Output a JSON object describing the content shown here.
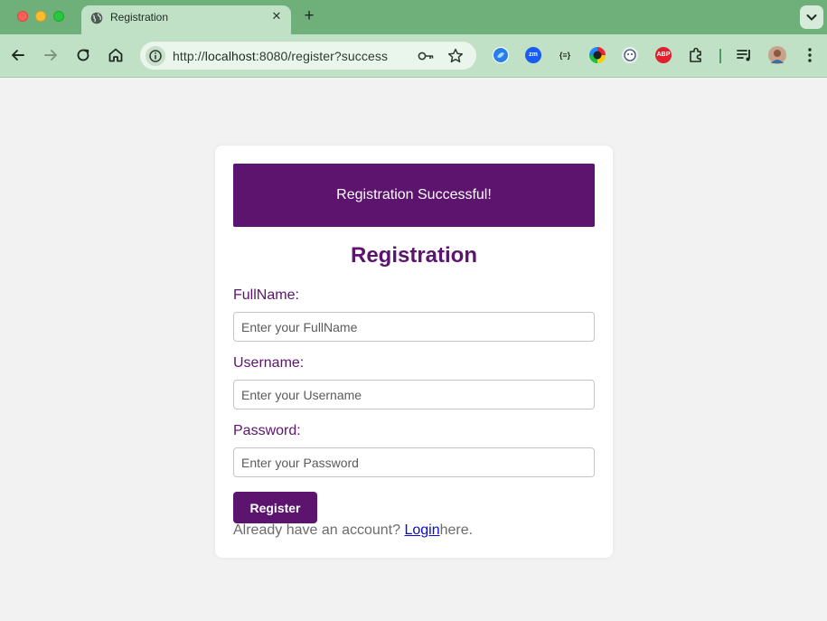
{
  "browser": {
    "tab_title": "Registration",
    "url_prefix": "http://",
    "url_host": "localhost",
    "url_rest": ":8080/register?success",
    "extensions": [
      "zm",
      "{≡}",
      "ABP"
    ]
  },
  "page": {
    "alert": "Registration Successful!",
    "title": "Registration",
    "fullname_label": "FullName:",
    "fullname_placeholder": "Enter your FullName",
    "username_label": "Username:",
    "username_placeholder": "Enter your Username",
    "password_label": "Password:",
    "password_placeholder": "Enter your Password",
    "register_button": "Register",
    "login_prefix": "Already have an account? ",
    "login_link": "Login",
    "login_suffix": "here."
  },
  "colors": {
    "accent": "#5c146f",
    "page_bg": "#f2f2f2",
    "tabbar": "#6fb07a",
    "toolbar": "#c1e1c6"
  }
}
